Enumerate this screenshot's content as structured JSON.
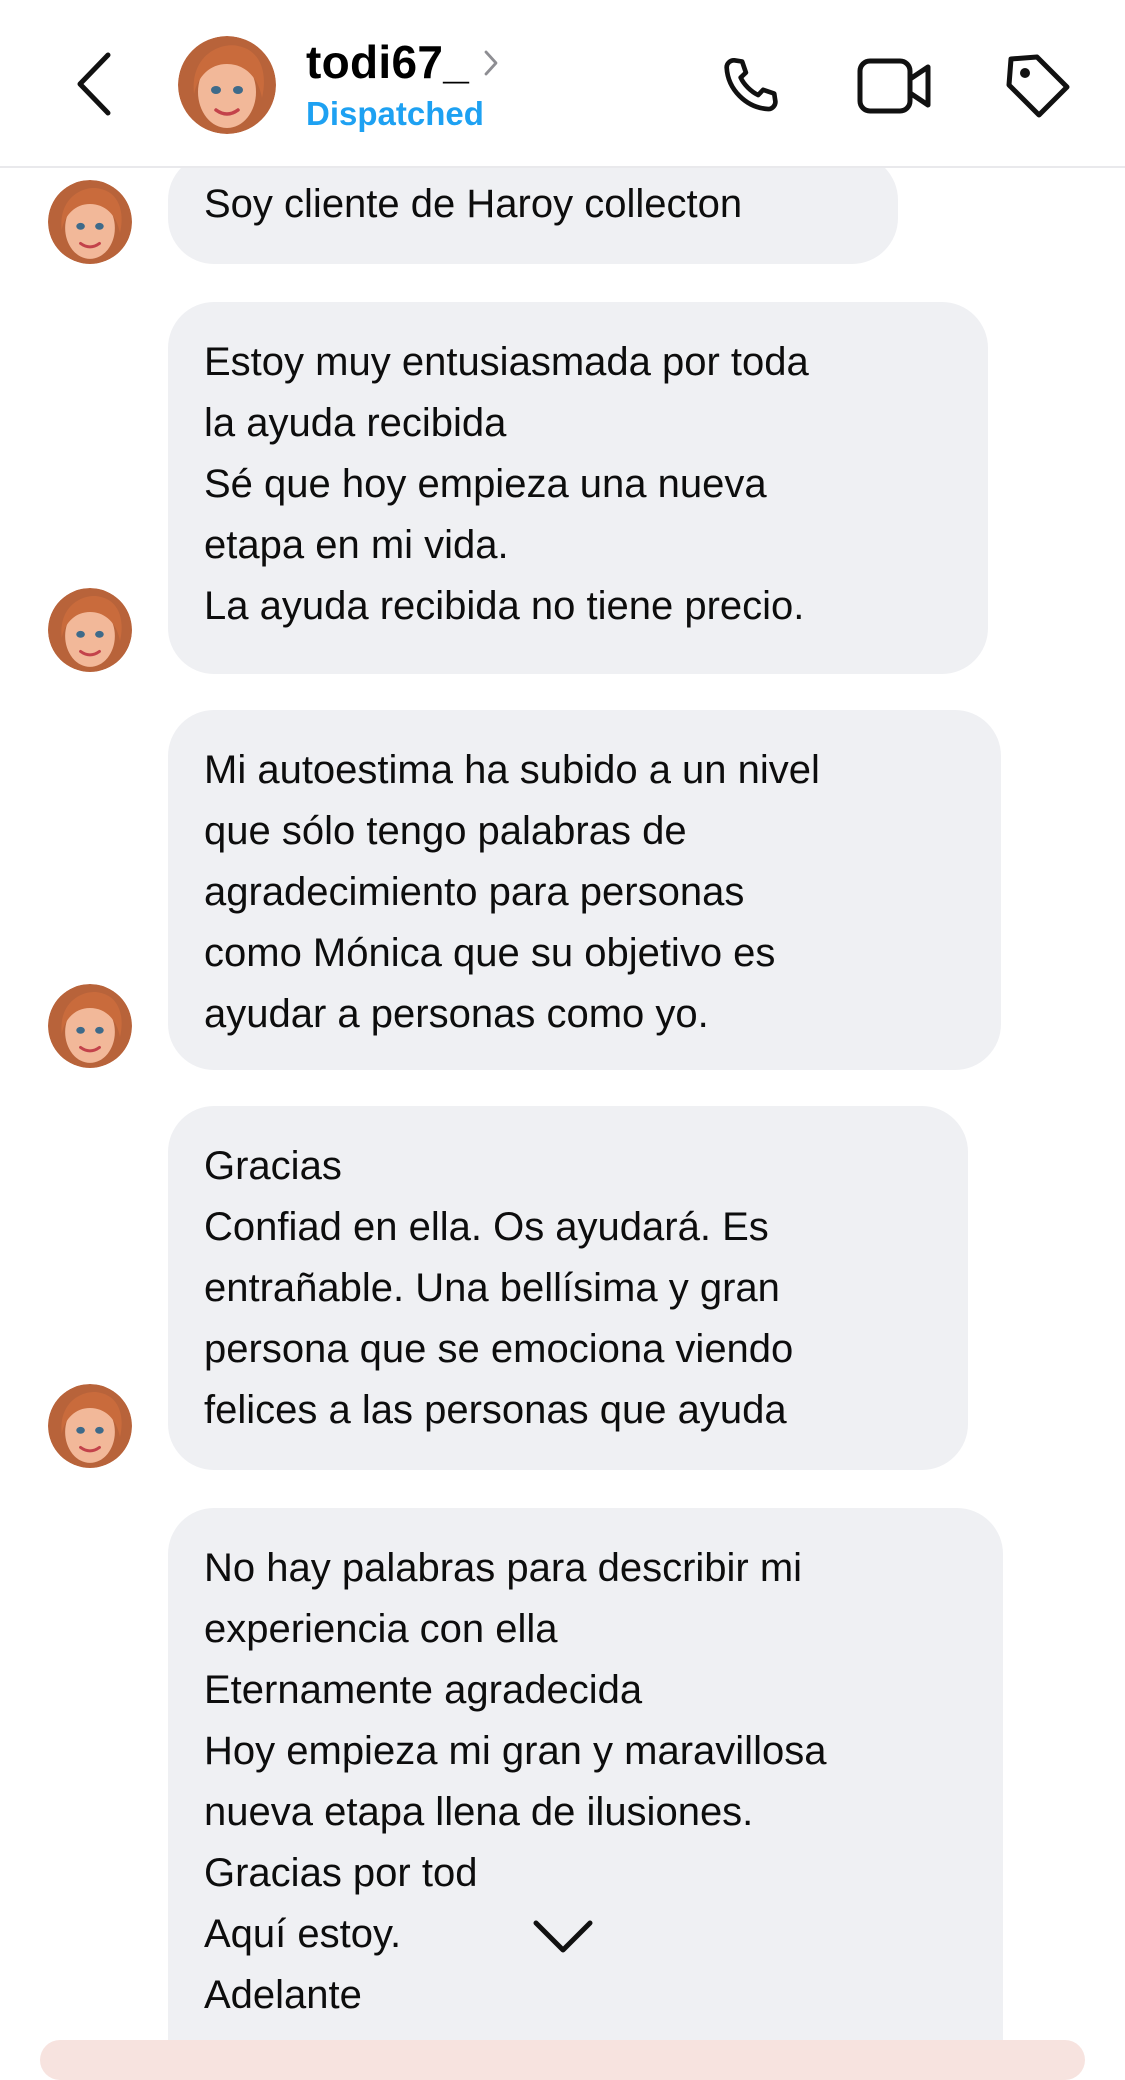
{
  "header": {
    "username": "todi67_",
    "status": "Dispatched",
    "status_color": "#1ea1f2",
    "icons": [
      "back-chevron-icon",
      "chevron-right-icon",
      "phone-icon",
      "video-camera-icon",
      "tag-icon"
    ]
  },
  "messages": [
    {
      "lines": [
        "Soy cliente de Haroy collecton"
      ]
    },
    {
      "lines": [
        "Estoy muy entusiasmada por toda",
        "la ayuda recibida",
        "Sé que hoy empieza una nueva",
        "etapa en mi vida.",
        "La ayuda recibida no tiene precio."
      ]
    },
    {
      "lines": [
        "Mi autoestima ha subido a un nivel",
        "que sólo tengo palabras de",
        "agradecimiento para personas",
        "como Mónica que su objetivo es",
        "ayudar a personas como yo."
      ]
    },
    {
      "lines": [
        "Gracias",
        "Confiad en ella. Os ayudará. Es",
        "entrañable. Una bellísima y gran",
        "persona que se emociona viendo",
        "felices a las personas que ayuda"
      ]
    },
    {
      "lines": [
        "No hay palabras para describir mi",
        "experiencia con ella",
        "Eternamente agradecida",
        "Hoy empieza mi gran y maravillosa",
        "nueva etapa llena de ilusiones.",
        "Gracias por tod",
        "Aquí estoy.",
        "Adelante"
      ]
    }
  ],
  "colors": {
    "bubble": "#eff0f3",
    "text": "#0d0d0d",
    "divider": "#e9e9ec"
  }
}
